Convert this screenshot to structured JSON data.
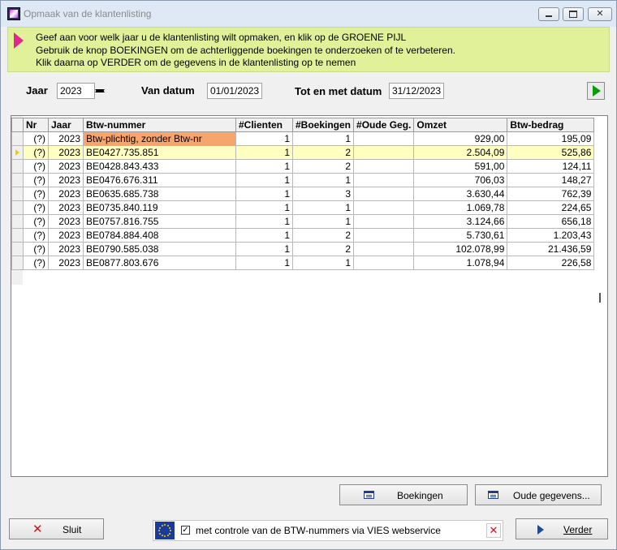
{
  "window": {
    "title": "Opmaak van de klantenlisting"
  },
  "banner": {
    "lines": [
      "Geef aan voor welk jaar u de klantenlisting wilt opmaken, en klik op de GROENE PIJL",
      "Gebruik de knop BOEKINGEN om de achterliggende boekingen te onderzoeken of te verbeteren.",
      "Klik daarna op VERDER om de gegevens in de klantenlisting op te nemen"
    ],
    "color": "#e1f19a"
  },
  "filters": {
    "jaar_label": "Jaar",
    "jaar_value": "2023",
    "van_label": "Van datum",
    "van_value": "01/01/2023",
    "tot_label": "Tot en met datum",
    "tot_value": "31/12/2023"
  },
  "grid": {
    "columns": [
      "Nr",
      "Jaar",
      "Btw-nummer",
      "#Clienten",
      "#Boekingen",
      "#Oude Geg.",
      "Omzet",
      "Btw-bedrag"
    ],
    "rows": [
      {
        "nr": "(?)",
        "jaar": "2023",
        "btw": "Btw-plichtig, zonder Btw-nr",
        "clienten": "1",
        "boekingen": "1",
        "oude": "",
        "omzet": "929,00",
        "bedrag": "195,09"
      },
      {
        "nr": "(?)",
        "jaar": "2023",
        "btw": "BE0427.735.851",
        "clienten": "1",
        "boekingen": "2",
        "oude": "",
        "omzet": "2.504,09",
        "bedrag": "525,86"
      },
      {
        "nr": "(?)",
        "jaar": "2023",
        "btw": "BE0428.843.433",
        "clienten": "1",
        "boekingen": "2",
        "oude": "",
        "omzet": "591,00",
        "bedrag": "124,11"
      },
      {
        "nr": "(?)",
        "jaar": "2023",
        "btw": "BE0476.676.311",
        "clienten": "1",
        "boekingen": "1",
        "oude": "",
        "omzet": "706,03",
        "bedrag": "148,27"
      },
      {
        "nr": "(?)",
        "jaar": "2023",
        "btw": "BE0635.685.738",
        "clienten": "1",
        "boekingen": "3",
        "oude": "",
        "omzet": "3.630,44",
        "bedrag": "762,39"
      },
      {
        "nr": "(?)",
        "jaar": "2023",
        "btw": "BE0735.840.119",
        "clienten": "1",
        "boekingen": "1",
        "oude": "",
        "omzet": "1.069,78",
        "bedrag": "224,65"
      },
      {
        "nr": "(?)",
        "jaar": "2023",
        "btw": "BE0757.816.755",
        "clienten": "1",
        "boekingen": "1",
        "oude": "",
        "omzet": "3.124,66",
        "bedrag": "656,18"
      },
      {
        "nr": "(?)",
        "jaar": "2023",
        "btw": "BE0784.884.408",
        "clienten": "1",
        "boekingen": "2",
        "oude": "",
        "omzet": "5.730,61",
        "bedrag": "1.203,43"
      },
      {
        "nr": "(?)",
        "jaar": "2023",
        "btw": "BE0790.585.038",
        "clienten": "1",
        "boekingen": "2",
        "oude": "",
        "omzet": "102.078,99",
        "bedrag": "21.436,59"
      },
      {
        "nr": "(?)",
        "jaar": "2023",
        "btw": "BE0877.803.676",
        "clienten": "1",
        "boekingen": "1",
        "oude": "",
        "omzet": "1.078,94",
        "bedrag": "226,58"
      }
    ],
    "selected_row": 1,
    "warning_color": "#f7a56c",
    "selected_color": "#ffffc2"
  },
  "buttons": {
    "boekingen": "Boekingen",
    "oude_gegevens": "Oude gegevens...",
    "sluit": "Sluit",
    "verder": "Verder"
  },
  "vies": {
    "checked": true,
    "label": "met controle van de BTW-nummers via VIES webservice"
  },
  "icons": {
    "app": "app-icon",
    "banner": "pointer-arrow-icon",
    "go": "green-arrow-icon",
    "list": "list-icon",
    "close": "red-x-icon",
    "next": "play-icon",
    "eu": "eu-flag-icon"
  }
}
